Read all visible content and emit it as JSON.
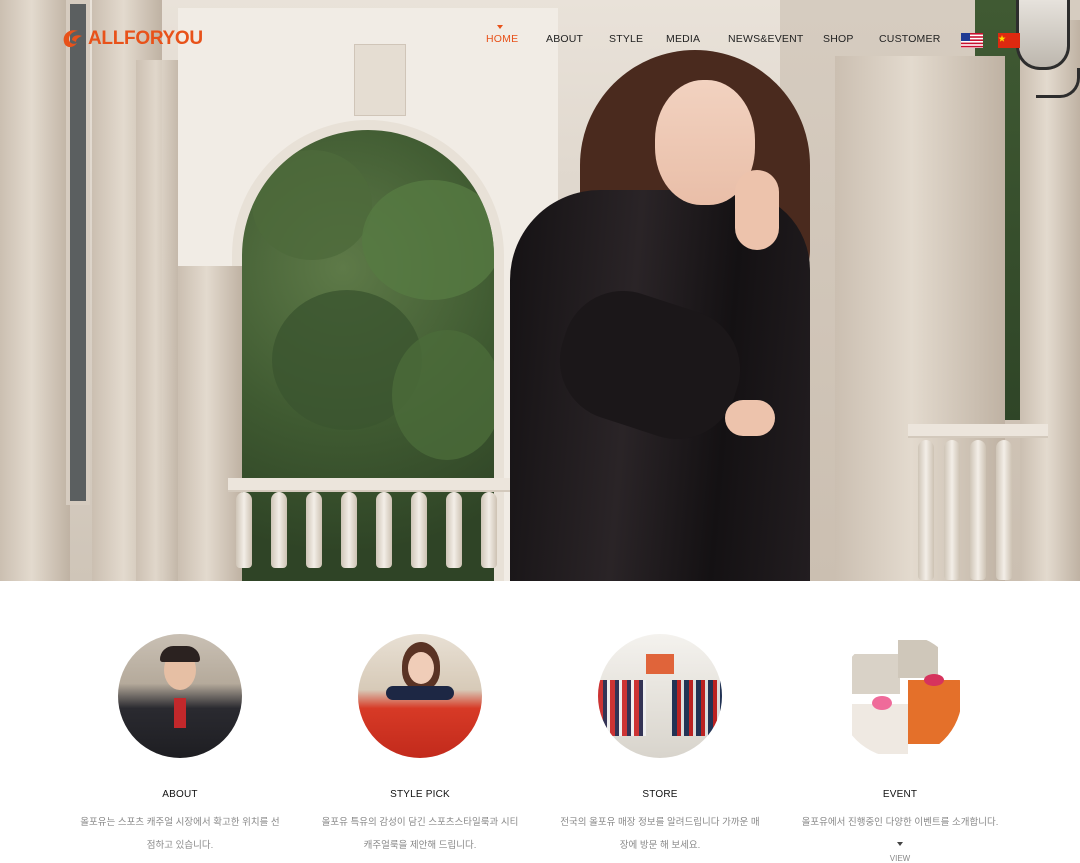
{
  "brand": {
    "name": "ALLFORYOU",
    "color": "#e8521a"
  },
  "nav": {
    "items": [
      {
        "label": "HOME",
        "active": true
      },
      {
        "label": "ABOUT",
        "active": false
      },
      {
        "label": "STYLE",
        "active": false
      },
      {
        "label": "MEDIA",
        "active": false
      },
      {
        "label": "NEWS&EVENT",
        "active": false
      },
      {
        "label": "SHOP",
        "active": false
      },
      {
        "label": "CUSTOMER",
        "active": false
      }
    ],
    "languages": [
      {
        "icon": "us-flag-icon"
      },
      {
        "icon": "china-flag-icon"
      }
    ]
  },
  "hero": {
    "image": "model-in-black-fur-coat"
  },
  "features": [
    {
      "title": "ABOUT",
      "desc": "올포유는 스포츠 캐주얼 시장에서 확고한 위치를 선점하고 있습니다.",
      "image": "male-model-padded-jacket"
    },
    {
      "title": "STYLE PICK",
      "desc": "올포유 특유의 감성이 담긴 스포츠스타일룩과 시티 캐주얼룩을 제안해 드립니다.",
      "image": "female-model-red-jacket"
    },
    {
      "title": "STORE",
      "desc": "전국의 올포유 매장 정보를 알려드립니다 가까운 매장에 방문 해 보세요.",
      "image": "store-interior"
    },
    {
      "title": "EVENT",
      "desc": "올포유에서 진행중인 다양한 이벤트를 소개합니다.",
      "image": "gift-boxes"
    }
  ],
  "view_more": {
    "label": "VIEW"
  }
}
